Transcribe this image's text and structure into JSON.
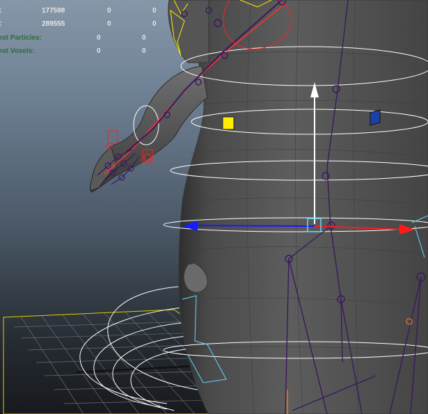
{
  "hud": {
    "rows": [
      {
        "label": ":",
        "values": [
          "177598",
          "0",
          "0"
        ],
        "style": "white"
      },
      {
        "label": ":",
        "values": [
          "289555",
          "0",
          "0"
        ],
        "style": "white"
      },
      {
        "label": "ost Particles:",
        "values": [
          "0",
          "0"
        ],
        "style": "green"
      },
      {
        "label": "ost Voxels:",
        "values": [
          "0",
          "0"
        ],
        "style": "green"
      }
    ]
  },
  "colors": {
    "bg_top": "#8697a9",
    "bg_bottom": "#17191d",
    "mesh": "#4b4b4b",
    "skeleton": "#3a1a5c",
    "control_curve": "#ffffff",
    "manipulator_x": "#ff1a1a",
    "manipulator_y": "#ffffff",
    "manipulator_z": "#1a1aff",
    "grid_outline": "#e0d000",
    "selection": "#ff2020",
    "locator_cyan": "#66d8ff",
    "yellow_marker": "#ffee00",
    "blue_marker": "#1c3fa8"
  }
}
